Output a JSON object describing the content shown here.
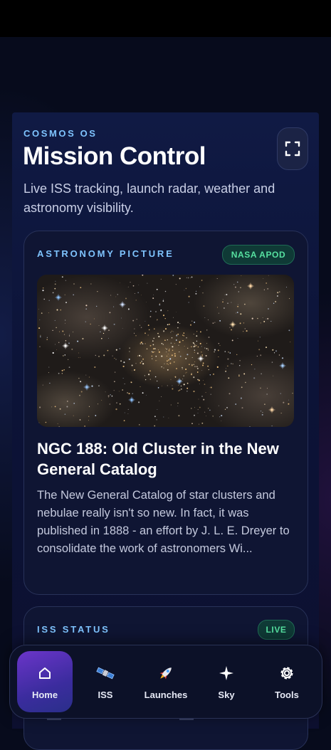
{
  "header": {
    "eyebrow": "COSMOS OS",
    "title": "Mission Control",
    "subtitle": "Live ISS tracking, launch radar, weather and astronomy visibility."
  },
  "apod_card": {
    "label": "ASTRONOMY PICTURE",
    "badge": "NASA APOD",
    "image_icon": "star-cluster-photo",
    "title": "NGC 188: Old Cluster in the New General Catalog",
    "description": "The New General Catalog of star clusters and nebulae really isn't so new. In fact, it was published in 1888 - an effort by J. L. E. Dreyer to consolidate the work of astronomers Wi..."
  },
  "iss_card": {
    "label": "ISS STATUS",
    "badge": "LIVE"
  },
  "nav": {
    "items": [
      {
        "label": "Home",
        "icon": "home-icon",
        "active": true
      },
      {
        "label": "ISS",
        "icon": "satellite-icon",
        "active": false
      },
      {
        "label": "Launches",
        "icon": "rocket-icon",
        "active": false
      },
      {
        "label": "Sky",
        "icon": "sparkle-icon",
        "active": false
      },
      {
        "label": "Tools",
        "icon": "gear-icon",
        "active": false
      }
    ]
  },
  "colors": {
    "accent": "#7fc4ff",
    "badge_green": "#56e0a0",
    "nav_active": "#6b35c9",
    "background": "#070b1c"
  }
}
